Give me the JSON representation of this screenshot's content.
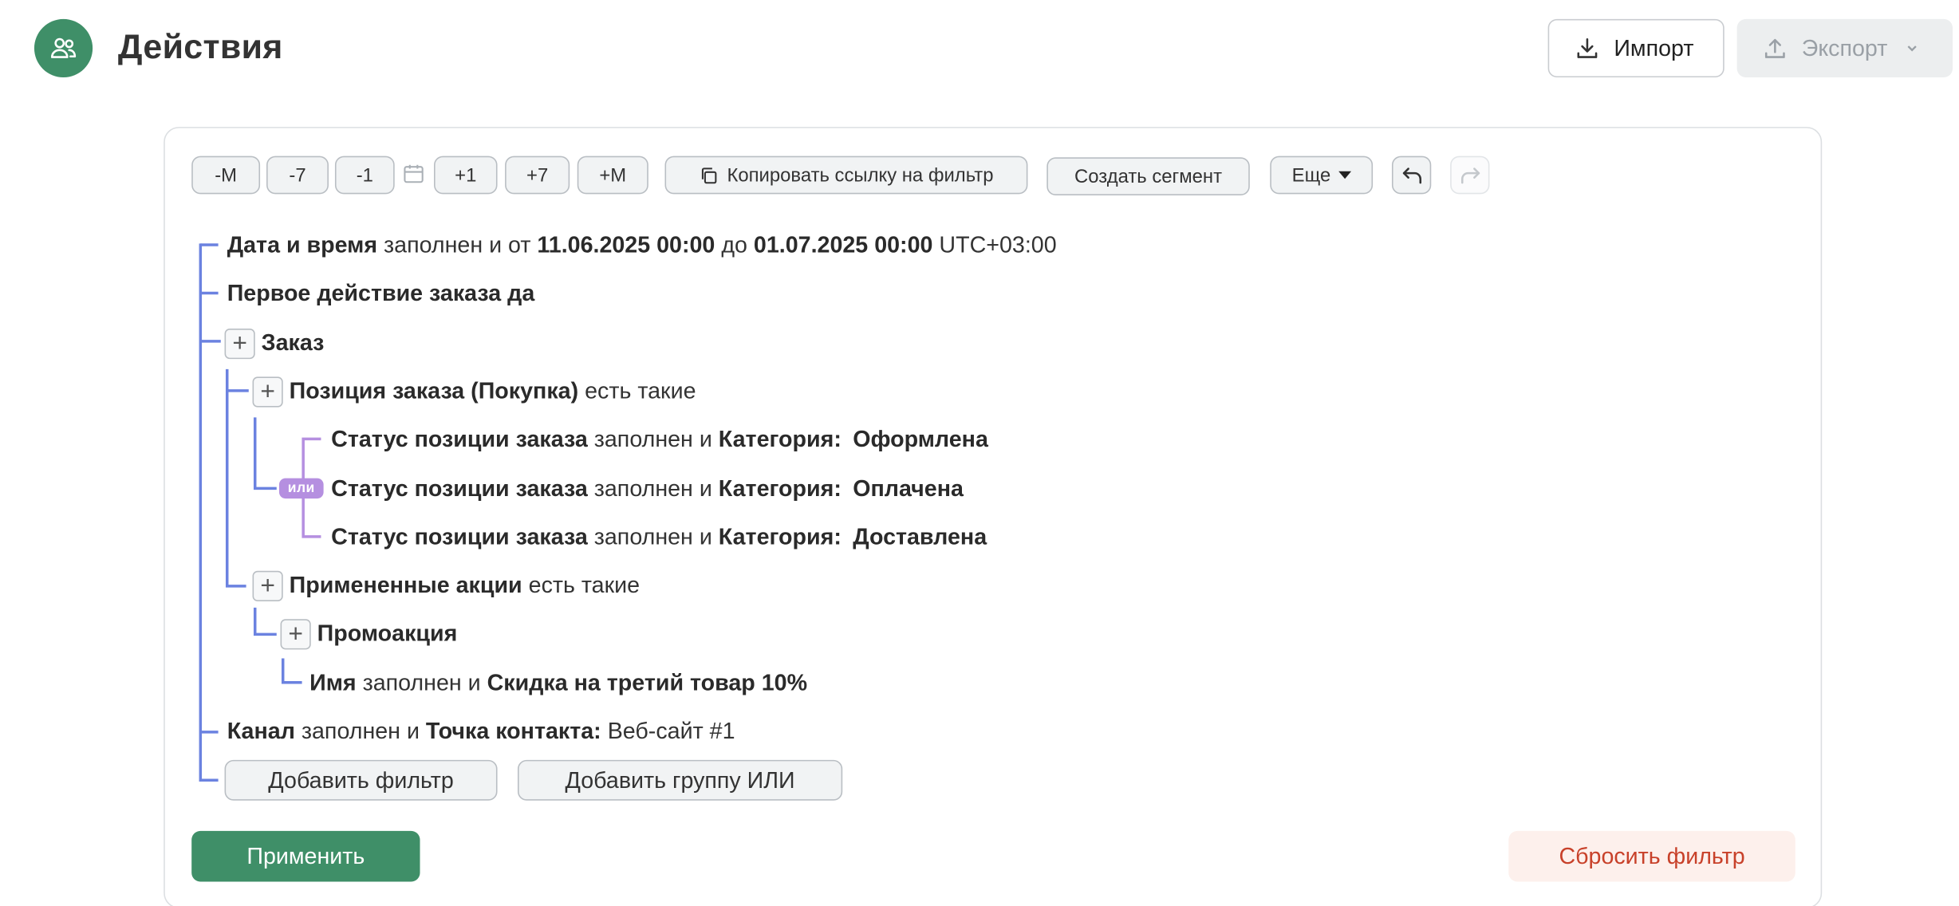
{
  "header": {
    "title": "Действия",
    "import_label": "Импорт",
    "export_label": "Экспорт"
  },
  "toolbar": {
    "minus_month": "-M",
    "minus_7": "-7",
    "minus_1": "-1",
    "plus_1": "+1",
    "plus_7": "+7",
    "plus_month": "+M",
    "copy_link": "Копировать ссылку на фильтр",
    "create_segment": "Создать сегмент",
    "more": "Еще"
  },
  "filters": {
    "date": {
      "field": "Дата и время",
      "op": "заполнен и от",
      "from": "11.06.2025 00:00",
      "to_word": "до",
      "to": "01.07.2025 00:00",
      "tz": "UTC+03:00"
    },
    "first_action": "Первое действие заказа да",
    "order": "Заказ",
    "order_item": {
      "field": "Позиция заказа (Покупка)",
      "op": "есть такие"
    },
    "or_label": "или",
    "status_rows": [
      {
        "field": "Статус позиции заказа",
        "op": "заполнен и",
        "cat": "Категория:",
        "value": "Оформлена"
      },
      {
        "field": "Статус позиции заказа",
        "op": "заполнен и",
        "cat": "Категория:",
        "value": "Оплачена"
      },
      {
        "field": "Статус позиции заказа",
        "op": "заполнен и",
        "cat": "Категория:",
        "value": "Доставлена"
      }
    ],
    "applied_promos": {
      "field": "Примененные акции",
      "op": "есть такие"
    },
    "promo": "Промоакция",
    "name": {
      "field": "Имя",
      "op": "заполнен и",
      "value": "Скидка на третий товар 10%"
    },
    "channel": {
      "field": "Канал",
      "op": "заполнен и",
      "cat": "Точка контакта:",
      "value": "Веб-сайт #1"
    }
  },
  "actions": {
    "add_filter": "Добавить фильтр",
    "add_or_group": "Добавить группу ИЛИ",
    "apply": "Применить",
    "reset": "Сбросить фильтр"
  },
  "colors": {
    "primary": "#3f8f68",
    "tree_line": "#6b82e0",
    "or_line": "#b58fe0",
    "danger_text": "#c8412a"
  }
}
